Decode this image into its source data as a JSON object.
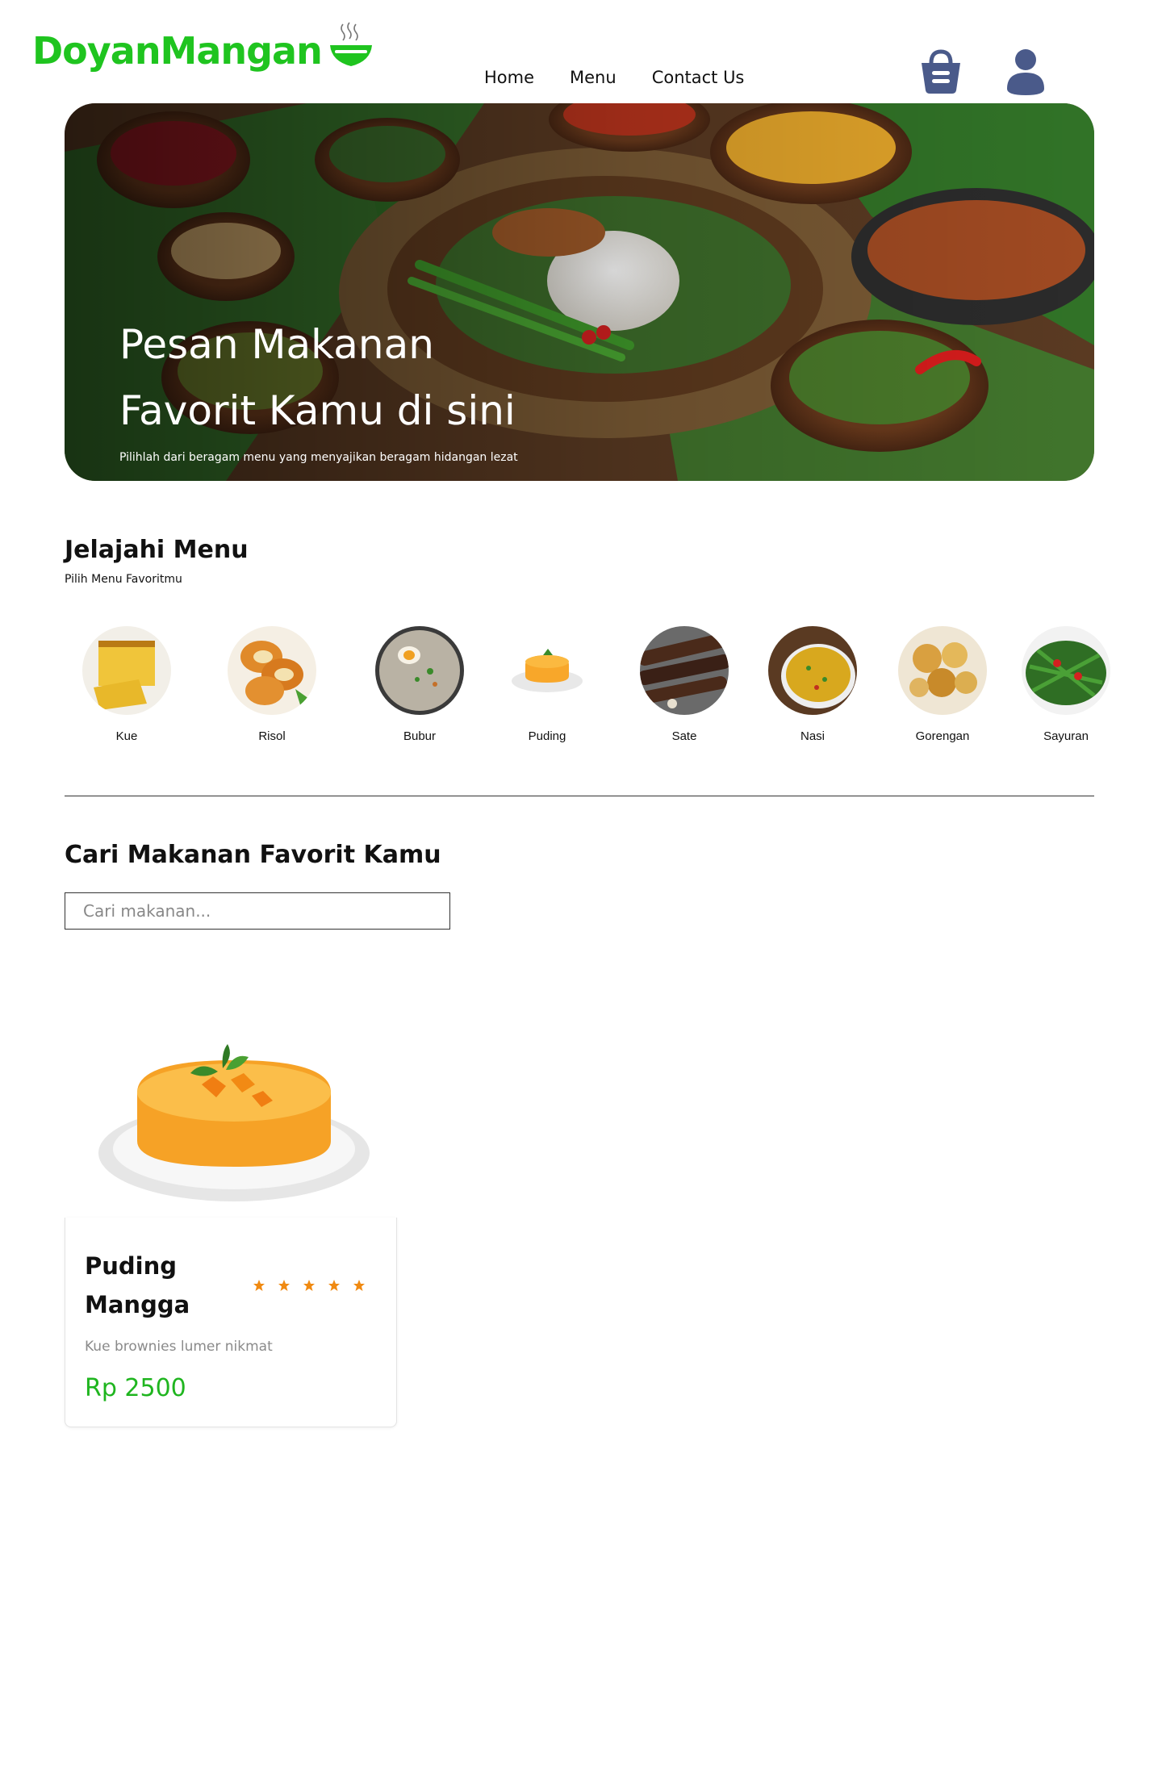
{
  "brand": {
    "name": "DoyanMangan",
    "color": "#1fc41f",
    "logo_icon": "steaming-bowl-icon"
  },
  "nav": {
    "items": [
      "Home",
      "Menu",
      "Contact Us"
    ]
  },
  "header_icons": {
    "cart": "shopping-basket-icon",
    "user": "user-icon",
    "icon_color": "#4a5a8a"
  },
  "hero": {
    "title_line1": "Pesan Makanan",
    "title_line2": "Favorit Kamu di sini",
    "subtitle": "Pilihlah dari beragam menu yang menyajikan beragam hidangan lezat"
  },
  "explore": {
    "title": "Jelajahi Menu",
    "subtitle": "Pilih Menu Favoritmu",
    "categories": [
      "Kue",
      "Risol",
      "Bubur",
      "Puding",
      "Sate",
      "Nasi",
      "Gorengan",
      "Sayuran"
    ]
  },
  "search": {
    "title": "Cari Makanan Favorit Kamu",
    "placeholder": "Cari makanan...",
    "value": ""
  },
  "products": [
    {
      "name": "Puding Mangga",
      "description": "Kue brownies lumer nikmat",
      "price": "Rp 2500",
      "rating": 5,
      "star_color": "#f08a12"
    }
  ],
  "colors": {
    "price": "#1fb51f",
    "star": "#f08a12"
  }
}
